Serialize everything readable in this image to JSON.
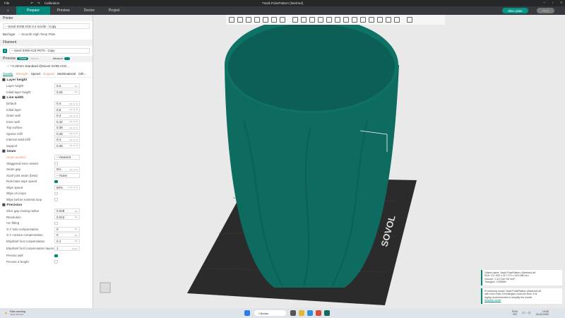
{
  "window": {
    "title": "*Vază-PolarPattern (Meshed)",
    "menu_file": "File",
    "menu_calibration": "Calibration"
  },
  "tabs": [
    {
      "label": "Prepare"
    },
    {
      "label": "Preview"
    },
    {
      "label": "Device"
    },
    {
      "label": "Project"
    }
  ],
  "actions": {
    "slice": "Slice plate",
    "print": "Print"
  },
  "printer": {
    "header": "Printer",
    "name": "-- Sovol SV06 ACE 0.4 nozzle - Copy",
    "bed_label": "Bed type",
    "bed_value": "-- Smooth High Temp Plate"
  },
  "filament": {
    "header": "Filament",
    "index": "1",
    "name": "-- Sovol SV06 ACE PETG - Copy"
  },
  "process": {
    "header": "Process",
    "toggle_global": "Global",
    "toggle_objects": "Objects",
    "advance": "Advance",
    "preset": "-- * 0.20mm Standard @Sovol SV06 ACE..."
  },
  "subtabs": [
    "Quality",
    "Strength",
    "Speed",
    "Support",
    "Multimaterial",
    "Oth..."
  ],
  "groups": [
    {
      "title": "Layer height",
      "rows": [
        {
          "label": "Layer height",
          "value": "0.2",
          "unit": "mm"
        },
        {
          "label": "Initial layer height",
          "value": "0.25",
          "unit": "mm"
        }
      ]
    },
    {
      "title": "Line width",
      "rows": [
        {
          "label": "Default",
          "value": "0.4",
          "unit": "mm or %"
        },
        {
          "label": "Initial layer",
          "value": "0.5",
          "unit": "mm or %"
        },
        {
          "label": "Outer wall",
          "value": "0.4",
          "unit": "mm or %"
        },
        {
          "label": "Inner wall",
          "value": "0.42",
          "unit": "mm or %"
        },
        {
          "label": "Top surface",
          "value": "0.38",
          "unit": "mm or %"
        },
        {
          "label": "Sparse infill",
          "value": "0.45",
          "unit": "mm or %"
        },
        {
          "label": "Internal solid infill",
          "value": "0.4",
          "unit": "mm or %"
        },
        {
          "label": "Support",
          "value": "0.45",
          "unit": "mm or %"
        }
      ]
    },
    {
      "title": "Seam",
      "rows": [
        {
          "label": "Seam position",
          "value": "-- Nearest",
          "unit": ""
        },
        {
          "label": "Staggered inner seams",
          "check": false
        },
        {
          "label": "Seam gap",
          "value": "5%",
          "unit": "mm or %"
        },
        {
          "label": "Scarf joint seam (beta)",
          "value": "-- None",
          "unit": ""
        },
        {
          "label": "Role base wipe speed",
          "check": true
        },
        {
          "label": "Wipe speed",
          "value": "80%",
          "unit": "mm/s or %"
        },
        {
          "label": "Wipe on loops",
          "check": false
        },
        {
          "label": "Wipe before external loop",
          "check": false
        }
      ]
    },
    {
      "title": "Precision",
      "rows": [
        {
          "label": "Slice gap closing radius",
          "value": "0.049",
          "unit": "mm"
        },
        {
          "label": "Resolution",
          "value": "0.012",
          "unit": "mm"
        },
        {
          "label": "Arc fitting",
          "check": false
        },
        {
          "label": "X-Y hole compensation",
          "value": "0",
          "unit": "mm"
        },
        {
          "label": "X-Y contour compensation",
          "value": "0",
          "unit": "mm"
        },
        {
          "label": "Elephant foot compensation",
          "value": "0.1",
          "unit": "mm"
        },
        {
          "label": "Elephant foot compensation layers",
          "value": "1",
          "unit": "layers"
        },
        {
          "label": "Precise wall",
          "check": true
        },
        {
          "label": "Precise Z height",
          "check": false
        }
      ]
    }
  ],
  "notifications": [
    {
      "lines": [
        "Object name: Vază-PolarPattern (Meshed).stl",
        "Size: 217.052 x 217.172 x 240.088 mm",
        "Volume: 1.41713e+06 mm³",
        "Triangles: 1295890"
      ]
    },
    {
      "lines": [
        "Processing model 'Vază-PolarPattern (Meshed).stl'",
        "with more than 1M triangles could be slow. It is",
        "highly recommended to simplify the model."
      ],
      "link": "Simplify model"
    }
  ],
  "bed_brand": "SOVOL",
  "taskbar": {
    "weather_title": "Rain warning",
    "weather_sub": "Just issued",
    "search": "Căutare",
    "lang1": "ROU",
    "lang2": "RO",
    "time": "19:05",
    "date": "03.03.2025"
  },
  "colors": {
    "accent": "#00897b",
    "model": "#0e6b60"
  }
}
